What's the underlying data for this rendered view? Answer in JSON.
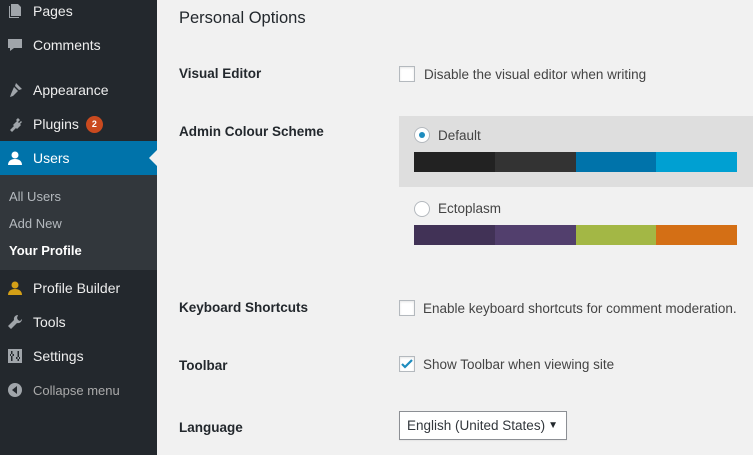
{
  "sidebar": {
    "items": [
      {
        "label": "Pages",
        "icon": "pages-icon"
      },
      {
        "label": "Comments",
        "icon": "comments-icon"
      },
      {
        "label": "Appearance",
        "icon": "appearance-icon"
      },
      {
        "label": "Plugins",
        "icon": "plugins-icon",
        "badge": "2"
      },
      {
        "label": "Users",
        "icon": "users-icon"
      },
      {
        "label": "Profile Builder",
        "icon": "profile-builder-icon"
      },
      {
        "label": "Tools",
        "icon": "tools-icon"
      },
      {
        "label": "Settings",
        "icon": "settings-icon"
      },
      {
        "label": "Collapse menu",
        "icon": "collapse-icon"
      }
    ],
    "submenu": [
      {
        "label": "All Users"
      },
      {
        "label": "Add New"
      },
      {
        "label": "Your Profile"
      }
    ]
  },
  "main": {
    "section_title": "Personal Options",
    "visual_editor": {
      "label": "Visual Editor",
      "option": "Disable the visual editor when writing",
      "checked": false
    },
    "colour_scheme": {
      "label": "Admin Colour Scheme",
      "schemes": [
        {
          "name": "Default",
          "selected": true,
          "colors": [
            "#222222",
            "#333333",
            "#0073aa",
            "#00a0d2"
          ]
        },
        {
          "name": "Ectoplasm",
          "selected": false,
          "colors": [
            "#413256",
            "#523f6d",
            "#a3b745",
            "#d46f15"
          ]
        }
      ]
    },
    "keyboard_shortcuts": {
      "label": "Keyboard Shortcuts",
      "option": "Enable keyboard shortcuts for comment moderation.",
      "checked": false
    },
    "toolbar": {
      "label": "Toolbar",
      "option": "Show Toolbar when viewing site",
      "checked": true
    },
    "language": {
      "label": "Language",
      "selected": "English (United States)"
    }
  },
  "colors": {
    "accent": "#0073aa",
    "sidebar_bg": "#23282d",
    "badge": "#ca4a1f"
  }
}
